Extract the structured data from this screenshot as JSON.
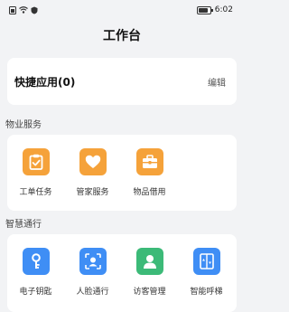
{
  "status": {
    "time": "6:02",
    "icons": [
      "sim-icon",
      "wifi-icon",
      "shield-icon",
      "battery-icon"
    ],
    "battery_level": 0.85
  },
  "header": {
    "title": "工作台"
  },
  "quick_apps": {
    "title": "快捷应用(0)",
    "edit_label": "编辑"
  },
  "property_services": {
    "title": "物业服务",
    "items": [
      {
        "label": "工单任务",
        "icon": "clipboard-check-icon",
        "color": "#f5a23a"
      },
      {
        "label": "管家服务",
        "icon": "heart-icon",
        "color": "#f5a23a"
      },
      {
        "label": "物品借用",
        "icon": "toolbox-icon",
        "color": "#f5a23a"
      }
    ]
  },
  "smart_access": {
    "title": "智慧通行",
    "items": [
      {
        "label": "电子钥匙",
        "icon": "key-icon",
        "color": "#3f8ef5"
      },
      {
        "label": "人脸通行",
        "icon": "face-scan-icon",
        "color": "#3f8ef5"
      },
      {
        "label": "访客管理",
        "icon": "visitor-icon",
        "color": "#3cba78"
      },
      {
        "label": "智能呼梯",
        "icon": "elevator-icon",
        "color": "#3f8ef5"
      }
    ]
  }
}
